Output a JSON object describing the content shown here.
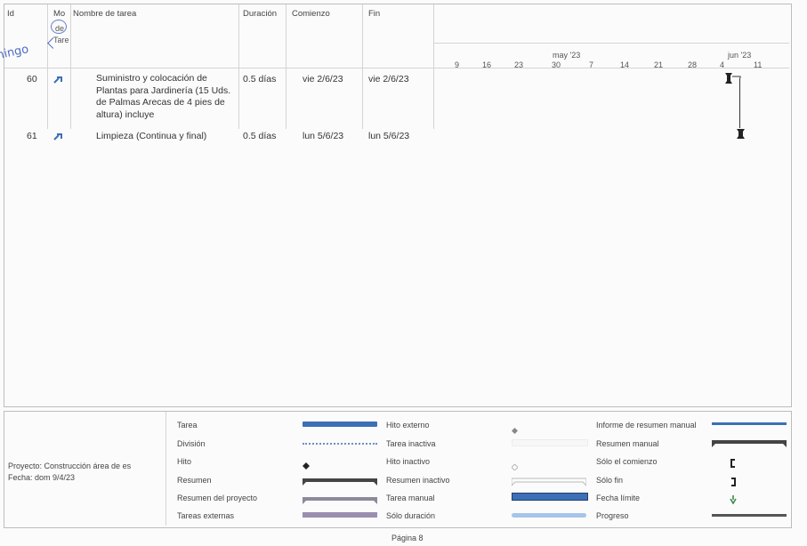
{
  "table": {
    "headers": {
      "id": "Id",
      "mode": "Mo",
      "mode_sub1": "de",
      "mode_sub2": "Tare",
      "name": "Nombre de tarea",
      "duration": "Duración",
      "start": "Comienzo",
      "finish": "Fin"
    },
    "rows": [
      {
        "id": "60",
        "name": "Suministro y colocación de Plantas para Jardinería (15 Uds. de Palmas Arecas de 4 pies de altura) incluye",
        "duration": "0.5 días",
        "start": "vie 2/6/23",
        "finish": "vie 2/6/23"
      },
      {
        "id": "61",
        "name": "Limpieza (Continua y final)",
        "duration": "0.5 días",
        "start": "lun 5/6/23",
        "finish": "lun 5/6/23"
      }
    ]
  },
  "timeline": {
    "months": [
      {
        "label": "may '23"
      },
      {
        "label": "jun '23"
      }
    ],
    "days": [
      "9",
      "16",
      "23",
      "30",
      "7",
      "14",
      "21",
      "28",
      "4",
      "11"
    ]
  },
  "annotation": {
    "handwriting": "Domingo"
  },
  "footer": {
    "project": "Proyecto: Construcción área de es",
    "date": "Fecha: dom 9/4/23",
    "page": "Página 8"
  },
  "legend": {
    "col1": [
      "Tarea",
      "División",
      "Hito",
      "Resumen",
      "Resumen del proyecto",
      "Tareas externas"
    ],
    "col2": [
      "Hito externo",
      "Tarea inactiva",
      "Hito inactivo",
      "Resumen inactivo",
      "Tarea manual",
      "Sólo duración"
    ],
    "col3": [
      "Informe de resumen manual",
      "Resumen manual",
      "Sólo el comienzo",
      "Sólo fin",
      "Fecha límite",
      "Progreso"
    ]
  },
  "colors": {
    "task_bar": "#3d6fb6",
    "summary_bar": "#444444",
    "milestone": "#222222",
    "handwriting": "#2f52b8"
  }
}
